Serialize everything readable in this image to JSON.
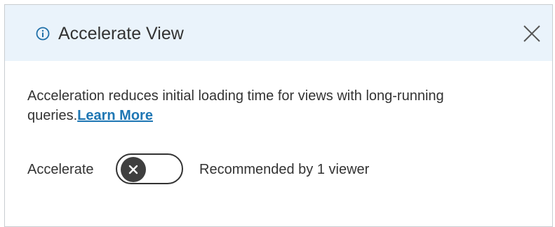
{
  "dialog": {
    "title": "Accelerate View",
    "title_icon": "info-icon",
    "close_icon": "close-icon",
    "description": "Acceleration reduces initial loading time for views with long-running queries.",
    "learn_more_label": "Learn More",
    "toggle_label": "Accelerate",
    "toggle_state": "off",
    "toggle_icon": "x-icon",
    "recommendation": "Recommended by 1 viewer"
  },
  "colors": {
    "header_bg": "#eaf3fb",
    "link": "#1f77b4",
    "text": "#333333",
    "toggle_knob": "#3f3f3f"
  }
}
